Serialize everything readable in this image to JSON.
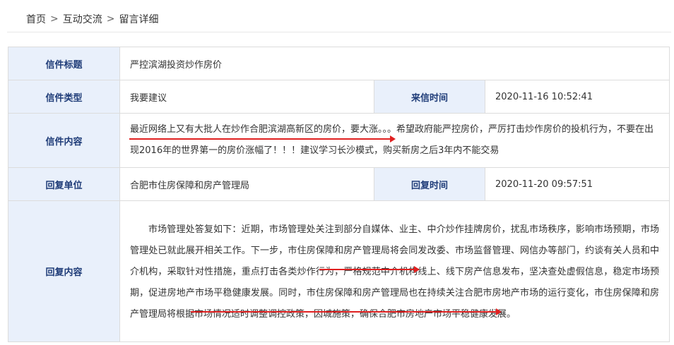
{
  "breadcrumb": {
    "home": "首页",
    "section": "互动交流",
    "current": "留言详细",
    "separator": ">"
  },
  "letter": {
    "title_label": "信件标题",
    "title": "严控滨湖投资炒作房价",
    "type_label": "信件类型",
    "type": "我要建议",
    "time_label": "来信时间",
    "time": "2020-11-16 10:52:41",
    "content_label": "信件内容",
    "content": "最近网络上又有大批人在炒作合肥滨湖高新区的房价，要大涨。。。希望政府能严控房价，严厉打击炒作房价的投机行为，不要在出现2016年的世界第一的房价涨幅了！！！建议学习长沙模式，购买新房之后3年内不能交易"
  },
  "reply": {
    "unit_label": "回复单位",
    "unit": "合肥市住房保障和房产管理局",
    "time_label": "回复时间",
    "time": "2020-11-20 09:57:51",
    "content_label": "回复内容",
    "content": "市场管理处答复如下：近期，市场管理处关注到部分自媒体、业主、中介炒作挂牌房价，扰乱市场秩序，影响市场预期，市场管理处已就此展开相关工作。下一步，市住房保障和房产管理局将会同发改委、市场监督管理、网信办等部门，约谈有关人员和中介机构，采取针对性措施，重点打击各类炒作行为，严格规范中介机构线上、线下房产信息发布，坚决查处虚假信息，稳定市场预期，促进房地产市场平稳健康发展。同时，市住房保障和房产管理局也在持续关注合肥市房地产市场的运行变化，市住房保障和房产管理局将根据市场情况适时调整调控政策，因城施策，确保合肥市房地产市场平稳健康发展。"
  },
  "colors": {
    "label_bg": "#e9f0fb",
    "label_text": "#1f3c78",
    "annotation": "#e02020"
  }
}
